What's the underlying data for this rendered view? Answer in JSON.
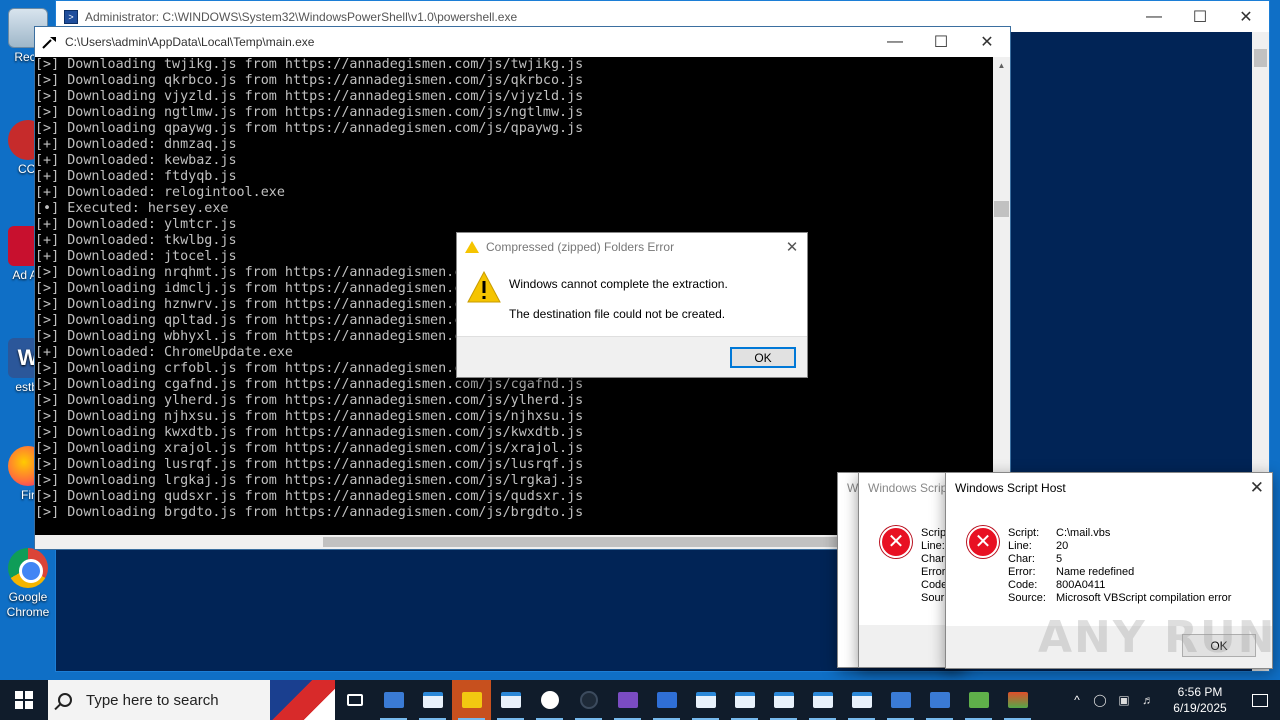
{
  "desktop": {
    "icons": [
      {
        "label": "Recy",
        "glyph": ""
      },
      {
        "label": "CCl",
        "glyph": ""
      },
      {
        "label": "Ad Ac",
        "glyph": ""
      },
      {
        "label": "estbl",
        "glyph": "W"
      },
      {
        "label": "Fir",
        "glyph": ""
      },
      {
        "label": "Google Chrome",
        "glyph": ""
      }
    ]
  },
  "powershell": {
    "title": "Administrator: C:\\WINDOWS\\System32\\WindowsPowerShell\\v1.0\\powershell.exe",
    "icon_glyph": ">"
  },
  "console": {
    "title": "C:\\Users\\admin\\AppData\\Local\\Temp\\main.exe",
    "lines": [
      "[>] Downloading twjikg.js from https://annadegismen.com/js/twjikg.js",
      "[>] Downloading qkrbco.js from https://annadegismen.com/js/qkrbco.js",
      "[>] Downloading vjyzld.js from https://annadegismen.com/js/vjyzld.js",
      "[>] Downloading ngtlmw.js from https://annadegismen.com/js/ngtlmw.js",
      "[>] Downloading qpaywg.js from https://annadegismen.com/js/qpaywg.js",
      "[+] Downloaded: dnmzaq.js",
      "[+] Downloaded: kewbaz.js",
      "[+] Downloaded: ftdyqb.js",
      "[+] Downloaded: relogintool.exe",
      "[•] Executed: hersey.exe",
      "[+] Downloaded: ylmtcr.js",
      "[+] Downloaded: tkwlbg.js",
      "[+] Downloaded: jtocel.js",
      "[>] Downloading nrqhmt.js from https://annadegismen.c",
      "[>] Downloading idmclj.js from https://annadegismen.c",
      "[>] Downloading hznwrv.js from https://annadegismen.c",
      "[>] Downloading qpltad.js from https://annadegismen.c",
      "[>] Downloading wbhyxl.js from https://annadegismen.c",
      "[+] Downloaded: ChromeUpdate.exe",
      "[>] Downloading crfobl.js from https://annadegismen.c",
      "[>] Downloading cgafnd.js from https://annadegismen.com/js/cgafnd.js",
      "[>] Downloading ylherd.js from https://annadegismen.com/js/ylherd.js",
      "[>] Downloading njhxsu.js from https://annadegismen.com/js/njhxsu.js",
      "[>] Downloading kwxdtb.js from https://annadegismen.com/js/kwxdtb.js",
      "[>] Downloading xrajol.js from https://annadegismen.com/js/xrajol.js",
      "[>] Downloading lusrqf.js from https://annadegismen.com/js/lusrqf.js",
      "[>] Downloading lrgkaj.js from https://annadegismen.com/js/lrgkaj.js",
      "[>] Downloading qudsxr.js from https://annadegismen.com/js/qudsxr.js",
      "[>] Downloading brgdto.js from https://annadegismen.com/js/brgdto.js"
    ]
  },
  "zip_dialog": {
    "title": "Compressed (zipped) Folders Error",
    "message1": "Windows cannot complete the extraction.",
    "message2": "The destination file could not be created.",
    "ok_label": "OK"
  },
  "wsh_back1": {
    "title": "Wi"
  },
  "wsh_back2": {
    "title": "Windows Scrip",
    "labels": [
      "Scrip",
      "Line:",
      "Char",
      "Error",
      "Code",
      "Sour"
    ]
  },
  "wsh_front": {
    "title": "Windows Script Host",
    "close_glyph": "✕",
    "rows": [
      {
        "k": "Script:",
        "v": "C:\\mail.vbs"
      },
      {
        "k": "Line:",
        "v": "20"
      },
      {
        "k": "Char:",
        "v": "5"
      },
      {
        "k": "Error:",
        "v": "Name redefined"
      },
      {
        "k": "Code:",
        "v": "800A0411"
      },
      {
        "k": "Source:",
        "v": "Microsoft VBScript compilation error"
      }
    ],
    "ok_label": "OK"
  },
  "watermark": "ANY RUN",
  "taskbar": {
    "search_placeholder": "Type here to search",
    "time": "6:56 PM",
    "date": "6/19/2025",
    "tray_chevron": "^"
  },
  "colors": {
    "desktop_bg": "#0f6fc6",
    "ps_bg": "#012456",
    "console_text": "#c0c0c0",
    "error_red": "#e81123",
    "taskbar": "#101c2b",
    "focus_blue": "#0078d7"
  }
}
